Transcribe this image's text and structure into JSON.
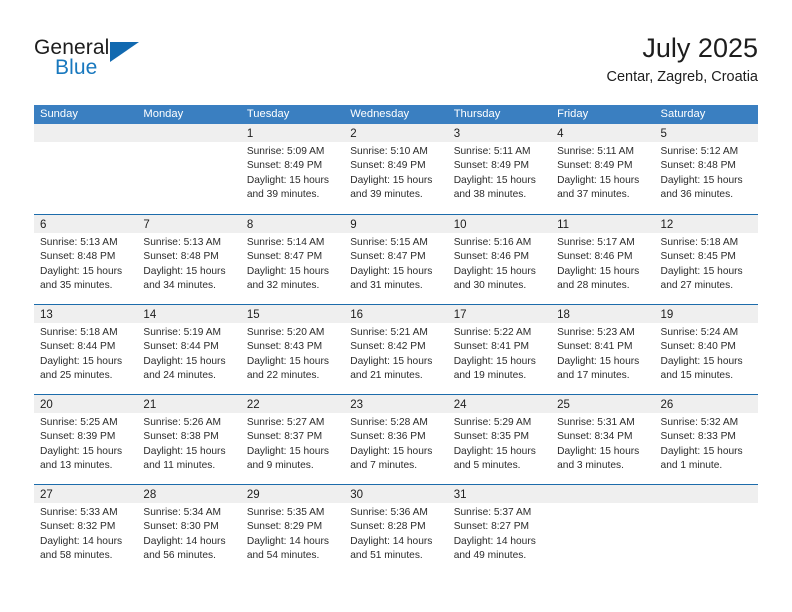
{
  "brand": {
    "name_part1": "General",
    "name_part2": "Blue",
    "mark": "triangle-logo"
  },
  "header": {
    "title": "July 2025",
    "location": "Centar, Zagreb, Croatia"
  },
  "weekdays": [
    "Sunday",
    "Monday",
    "Tuesday",
    "Wednesday",
    "Thursday",
    "Friday",
    "Saturday"
  ],
  "colors": {
    "header_blue": "#3a7fc1",
    "row_divider_blue": "#1d6cab",
    "day_band_gray": "#efefef",
    "brand_blue": "#1878be",
    "text": "#1d1d1d"
  },
  "weeks": [
    [
      {
        "day": "",
        "lines": [],
        "empty": true
      },
      {
        "day": "",
        "lines": [],
        "empty": true
      },
      {
        "day": "1",
        "lines": [
          "Sunrise: 5:09 AM",
          "Sunset: 8:49 PM",
          "Daylight: 15 hours",
          "and 39 minutes."
        ],
        "empty": false
      },
      {
        "day": "2",
        "lines": [
          "Sunrise: 5:10 AM",
          "Sunset: 8:49 PM",
          "Daylight: 15 hours",
          "and 39 minutes."
        ],
        "empty": false
      },
      {
        "day": "3",
        "lines": [
          "Sunrise: 5:11 AM",
          "Sunset: 8:49 PM",
          "Daylight: 15 hours",
          "and 38 minutes."
        ],
        "empty": false
      },
      {
        "day": "4",
        "lines": [
          "Sunrise: 5:11 AM",
          "Sunset: 8:49 PM",
          "Daylight: 15 hours",
          "and 37 minutes."
        ],
        "empty": false
      },
      {
        "day": "5",
        "lines": [
          "Sunrise: 5:12 AM",
          "Sunset: 8:48 PM",
          "Daylight: 15 hours",
          "and 36 minutes."
        ],
        "empty": false
      }
    ],
    [
      {
        "day": "6",
        "lines": [
          "Sunrise: 5:13 AM",
          "Sunset: 8:48 PM",
          "Daylight: 15 hours",
          "and 35 minutes."
        ],
        "empty": false
      },
      {
        "day": "7",
        "lines": [
          "Sunrise: 5:13 AM",
          "Sunset: 8:48 PM",
          "Daylight: 15 hours",
          "and 34 minutes."
        ],
        "empty": false
      },
      {
        "day": "8",
        "lines": [
          "Sunrise: 5:14 AM",
          "Sunset: 8:47 PM",
          "Daylight: 15 hours",
          "and 32 minutes."
        ],
        "empty": false
      },
      {
        "day": "9",
        "lines": [
          "Sunrise: 5:15 AM",
          "Sunset: 8:47 PM",
          "Daylight: 15 hours",
          "and 31 minutes."
        ],
        "empty": false
      },
      {
        "day": "10",
        "lines": [
          "Sunrise: 5:16 AM",
          "Sunset: 8:46 PM",
          "Daylight: 15 hours",
          "and 30 minutes."
        ],
        "empty": false
      },
      {
        "day": "11",
        "lines": [
          "Sunrise: 5:17 AM",
          "Sunset: 8:46 PM",
          "Daylight: 15 hours",
          "and 28 minutes."
        ],
        "empty": false
      },
      {
        "day": "12",
        "lines": [
          "Sunrise: 5:18 AM",
          "Sunset: 8:45 PM",
          "Daylight: 15 hours",
          "and 27 minutes."
        ],
        "empty": false
      }
    ],
    [
      {
        "day": "13",
        "lines": [
          "Sunrise: 5:18 AM",
          "Sunset: 8:44 PM",
          "Daylight: 15 hours",
          "and 25 minutes."
        ],
        "empty": false
      },
      {
        "day": "14",
        "lines": [
          "Sunrise: 5:19 AM",
          "Sunset: 8:44 PM",
          "Daylight: 15 hours",
          "and 24 minutes."
        ],
        "empty": false
      },
      {
        "day": "15",
        "lines": [
          "Sunrise: 5:20 AM",
          "Sunset: 8:43 PM",
          "Daylight: 15 hours",
          "and 22 minutes."
        ],
        "empty": false
      },
      {
        "day": "16",
        "lines": [
          "Sunrise: 5:21 AM",
          "Sunset: 8:42 PM",
          "Daylight: 15 hours",
          "and 21 minutes."
        ],
        "empty": false
      },
      {
        "day": "17",
        "lines": [
          "Sunrise: 5:22 AM",
          "Sunset: 8:41 PM",
          "Daylight: 15 hours",
          "and 19 minutes."
        ],
        "empty": false
      },
      {
        "day": "18",
        "lines": [
          "Sunrise: 5:23 AM",
          "Sunset: 8:41 PM",
          "Daylight: 15 hours",
          "and 17 minutes."
        ],
        "empty": false
      },
      {
        "day": "19",
        "lines": [
          "Sunrise: 5:24 AM",
          "Sunset: 8:40 PM",
          "Daylight: 15 hours",
          "and 15 minutes."
        ],
        "empty": false
      }
    ],
    [
      {
        "day": "20",
        "lines": [
          "Sunrise: 5:25 AM",
          "Sunset: 8:39 PM",
          "Daylight: 15 hours",
          "and 13 minutes."
        ],
        "empty": false
      },
      {
        "day": "21",
        "lines": [
          "Sunrise: 5:26 AM",
          "Sunset: 8:38 PM",
          "Daylight: 15 hours",
          "and 11 minutes."
        ],
        "empty": false
      },
      {
        "day": "22",
        "lines": [
          "Sunrise: 5:27 AM",
          "Sunset: 8:37 PM",
          "Daylight: 15 hours",
          "and 9 minutes."
        ],
        "empty": false
      },
      {
        "day": "23",
        "lines": [
          "Sunrise: 5:28 AM",
          "Sunset: 8:36 PM",
          "Daylight: 15 hours",
          "and 7 minutes."
        ],
        "empty": false
      },
      {
        "day": "24",
        "lines": [
          "Sunrise: 5:29 AM",
          "Sunset: 8:35 PM",
          "Daylight: 15 hours",
          "and 5 minutes."
        ],
        "empty": false
      },
      {
        "day": "25",
        "lines": [
          "Sunrise: 5:31 AM",
          "Sunset: 8:34 PM",
          "Daylight: 15 hours",
          "and 3 minutes."
        ],
        "empty": false
      },
      {
        "day": "26",
        "lines": [
          "Sunrise: 5:32 AM",
          "Sunset: 8:33 PM",
          "Daylight: 15 hours",
          "and 1 minute."
        ],
        "empty": false
      }
    ],
    [
      {
        "day": "27",
        "lines": [
          "Sunrise: 5:33 AM",
          "Sunset: 8:32 PM",
          "Daylight: 14 hours",
          "and 58 minutes."
        ],
        "empty": false
      },
      {
        "day": "28",
        "lines": [
          "Sunrise: 5:34 AM",
          "Sunset: 8:30 PM",
          "Daylight: 14 hours",
          "and 56 minutes."
        ],
        "empty": false
      },
      {
        "day": "29",
        "lines": [
          "Sunrise: 5:35 AM",
          "Sunset: 8:29 PM",
          "Daylight: 14 hours",
          "and 54 minutes."
        ],
        "empty": false
      },
      {
        "day": "30",
        "lines": [
          "Sunrise: 5:36 AM",
          "Sunset: 8:28 PM",
          "Daylight: 14 hours",
          "and 51 minutes."
        ],
        "empty": false
      },
      {
        "day": "31",
        "lines": [
          "Sunrise: 5:37 AM",
          "Sunset: 8:27 PM",
          "Daylight: 14 hours",
          "and 49 minutes."
        ],
        "empty": false
      },
      {
        "day": "",
        "lines": [],
        "empty": true
      },
      {
        "day": "",
        "lines": [],
        "empty": true
      }
    ]
  ]
}
